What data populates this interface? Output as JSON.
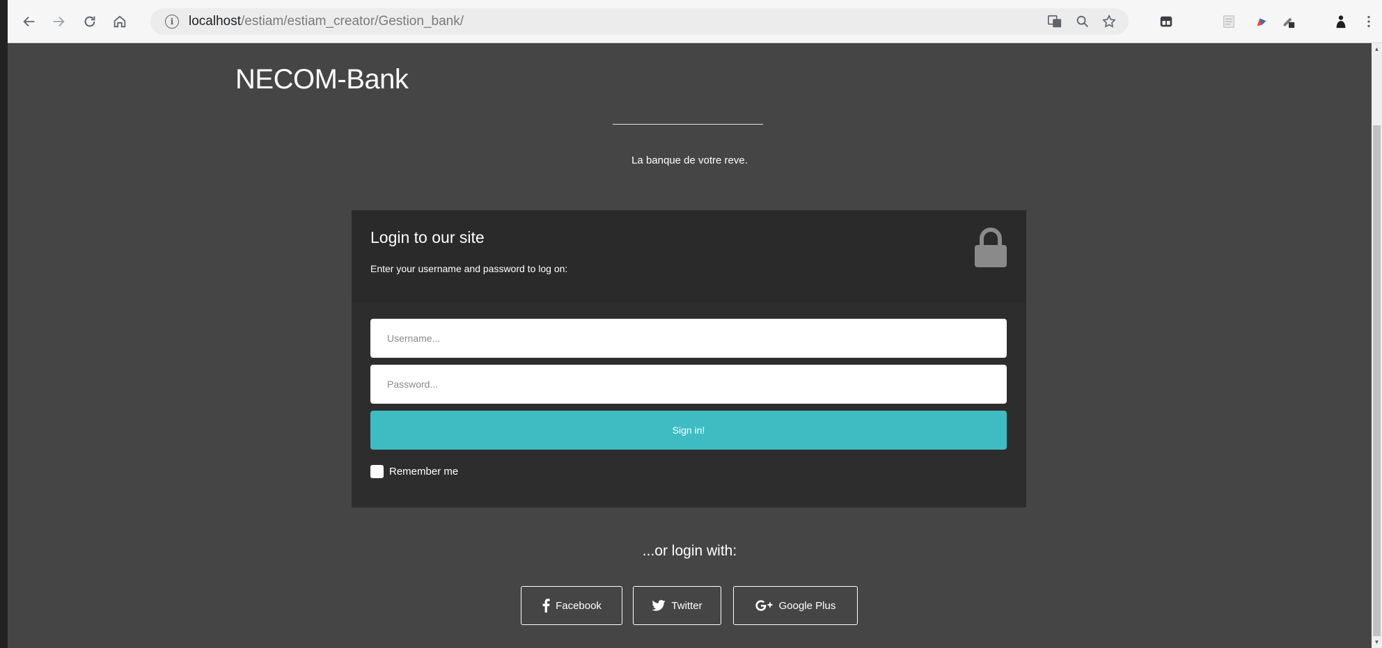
{
  "browser": {
    "url_host": "localhost",
    "url_path": "/estiam/estiam_creator/Gestion_bank/"
  },
  "page": {
    "brand": "NECOM-Bank",
    "tagline": "La banque de votre reve."
  },
  "login": {
    "title": "Login to our site",
    "subtitle": "Enter your username and password to log on:",
    "username_placeholder": "Username...",
    "password_placeholder": "Password...",
    "signin_label": "Sign in!",
    "remember_label": "Remember me"
  },
  "social": {
    "heading": "...or login with:",
    "buttons": [
      {
        "label": "Facebook",
        "icon": "facebook-icon"
      },
      {
        "label": "Twitter",
        "icon": "twitter-icon"
      },
      {
        "label": "Google Plus",
        "icon": "google-plus-icon"
      }
    ]
  },
  "colors": {
    "page_bg": "#454545",
    "card_bg": "#2d2d2d",
    "accent": "#3fbcc2"
  }
}
